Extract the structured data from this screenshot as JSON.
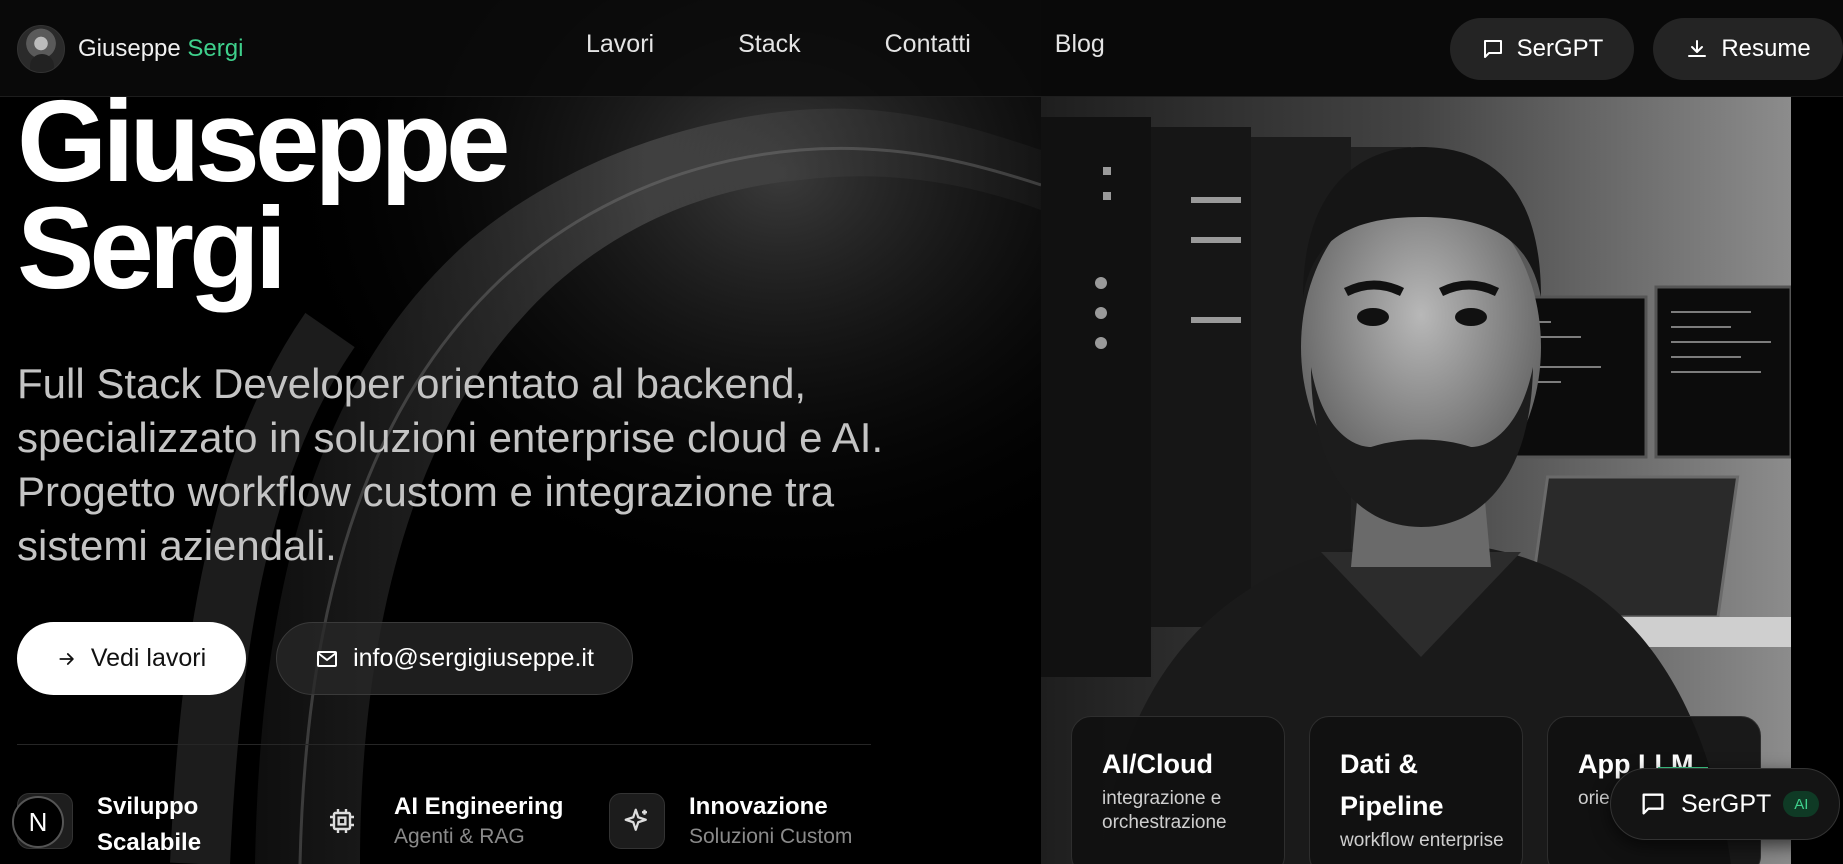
{
  "header": {
    "brand_first": "Giuseppe",
    "brand_last": "Sergi",
    "nav": [
      "Lavori",
      "Stack",
      "Contatti",
      "Blog"
    ],
    "chat_button": "SerGPT",
    "resume_button": "Resume"
  },
  "hero": {
    "title_line1": "Giuseppe",
    "title_line2": "Sergi",
    "description": "Full Stack Developer orientato al backend, specializzato in soluzioni enterprise cloud e AI. Progetto workflow custom e integrazione tra sistemi aziendali.",
    "cta_works": "Vedi lavori",
    "cta_email": "info@sergigiuseppe.it"
  },
  "features": [
    {
      "title_line1": "Sviluppo",
      "title_line2": "Scalabile",
      "icon": "layers-icon"
    },
    {
      "title": "AI Engineering",
      "subtitle": "Agenti & RAG",
      "icon": "cpu-icon"
    },
    {
      "title": "Innovazione",
      "subtitle": "Soluzioni Custom",
      "icon": "sparkle-icon"
    }
  ],
  "badge_letter": "N",
  "stats": [
    {
      "title": "AI/Cloud",
      "subtitle": "integrazione e orchestrazione"
    },
    {
      "title_line1": "Dati &",
      "title_line2": "Pipeline",
      "subtitle": "workflow enterprise"
    },
    {
      "title": "App LLM",
      "subtitle": "orie busi"
    }
  ],
  "floating_chat": {
    "label": "SerGPT",
    "badge": "AI"
  },
  "colors": {
    "accent": "#3fd08c",
    "background": "#000000",
    "pill": "#242424"
  }
}
